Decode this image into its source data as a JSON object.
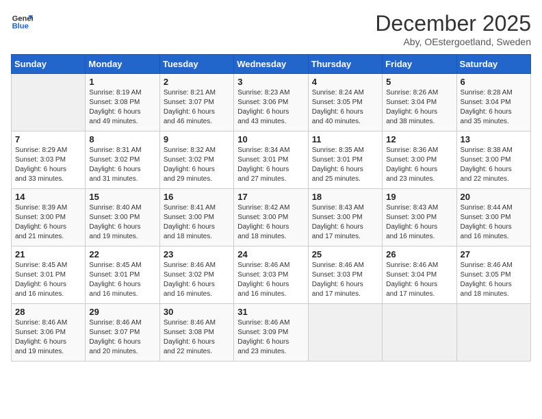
{
  "logo": {
    "line1": "General",
    "line2": "Blue"
  },
  "title": "December 2025",
  "subtitle": "Aby, OEstergoetland, Sweden",
  "days_of_week": [
    "Sunday",
    "Monday",
    "Tuesday",
    "Wednesday",
    "Thursday",
    "Friday",
    "Saturday"
  ],
  "weeks": [
    [
      {
        "day": "",
        "content": ""
      },
      {
        "day": "1",
        "content": "Sunrise: 8:19 AM\nSunset: 3:08 PM\nDaylight: 6 hours\nand 49 minutes."
      },
      {
        "day": "2",
        "content": "Sunrise: 8:21 AM\nSunset: 3:07 PM\nDaylight: 6 hours\nand 46 minutes."
      },
      {
        "day": "3",
        "content": "Sunrise: 8:23 AM\nSunset: 3:06 PM\nDaylight: 6 hours\nand 43 minutes."
      },
      {
        "day": "4",
        "content": "Sunrise: 8:24 AM\nSunset: 3:05 PM\nDaylight: 6 hours\nand 40 minutes."
      },
      {
        "day": "5",
        "content": "Sunrise: 8:26 AM\nSunset: 3:04 PM\nDaylight: 6 hours\nand 38 minutes."
      },
      {
        "day": "6",
        "content": "Sunrise: 8:28 AM\nSunset: 3:04 PM\nDaylight: 6 hours\nand 35 minutes."
      }
    ],
    [
      {
        "day": "7",
        "content": "Sunrise: 8:29 AM\nSunset: 3:03 PM\nDaylight: 6 hours\nand 33 minutes."
      },
      {
        "day": "8",
        "content": "Sunrise: 8:31 AM\nSunset: 3:02 PM\nDaylight: 6 hours\nand 31 minutes."
      },
      {
        "day": "9",
        "content": "Sunrise: 8:32 AM\nSunset: 3:02 PM\nDaylight: 6 hours\nand 29 minutes."
      },
      {
        "day": "10",
        "content": "Sunrise: 8:34 AM\nSunset: 3:01 PM\nDaylight: 6 hours\nand 27 minutes."
      },
      {
        "day": "11",
        "content": "Sunrise: 8:35 AM\nSunset: 3:01 PM\nDaylight: 6 hours\nand 25 minutes."
      },
      {
        "day": "12",
        "content": "Sunrise: 8:36 AM\nSunset: 3:00 PM\nDaylight: 6 hours\nand 23 minutes."
      },
      {
        "day": "13",
        "content": "Sunrise: 8:38 AM\nSunset: 3:00 PM\nDaylight: 6 hours\nand 22 minutes."
      }
    ],
    [
      {
        "day": "14",
        "content": "Sunrise: 8:39 AM\nSunset: 3:00 PM\nDaylight: 6 hours\nand 21 minutes."
      },
      {
        "day": "15",
        "content": "Sunrise: 8:40 AM\nSunset: 3:00 PM\nDaylight: 6 hours\nand 19 minutes."
      },
      {
        "day": "16",
        "content": "Sunrise: 8:41 AM\nSunset: 3:00 PM\nDaylight: 6 hours\nand 18 minutes."
      },
      {
        "day": "17",
        "content": "Sunrise: 8:42 AM\nSunset: 3:00 PM\nDaylight: 6 hours\nand 18 minutes."
      },
      {
        "day": "18",
        "content": "Sunrise: 8:43 AM\nSunset: 3:00 PM\nDaylight: 6 hours\nand 17 minutes."
      },
      {
        "day": "19",
        "content": "Sunrise: 8:43 AM\nSunset: 3:00 PM\nDaylight: 6 hours\nand 16 minutes."
      },
      {
        "day": "20",
        "content": "Sunrise: 8:44 AM\nSunset: 3:00 PM\nDaylight: 6 hours\nand 16 minutes."
      }
    ],
    [
      {
        "day": "21",
        "content": "Sunrise: 8:45 AM\nSunset: 3:01 PM\nDaylight: 6 hours\nand 16 minutes."
      },
      {
        "day": "22",
        "content": "Sunrise: 8:45 AM\nSunset: 3:01 PM\nDaylight: 6 hours\nand 16 minutes."
      },
      {
        "day": "23",
        "content": "Sunrise: 8:46 AM\nSunset: 3:02 PM\nDaylight: 6 hours\nand 16 minutes."
      },
      {
        "day": "24",
        "content": "Sunrise: 8:46 AM\nSunset: 3:03 PM\nDaylight: 6 hours\nand 16 minutes."
      },
      {
        "day": "25",
        "content": "Sunrise: 8:46 AM\nSunset: 3:03 PM\nDaylight: 6 hours\nand 17 minutes."
      },
      {
        "day": "26",
        "content": "Sunrise: 8:46 AM\nSunset: 3:04 PM\nDaylight: 6 hours\nand 17 minutes."
      },
      {
        "day": "27",
        "content": "Sunrise: 8:46 AM\nSunset: 3:05 PM\nDaylight: 6 hours\nand 18 minutes."
      }
    ],
    [
      {
        "day": "28",
        "content": "Sunrise: 8:46 AM\nSunset: 3:06 PM\nDaylight: 6 hours\nand 19 minutes."
      },
      {
        "day": "29",
        "content": "Sunrise: 8:46 AM\nSunset: 3:07 PM\nDaylight: 6 hours\nand 20 minutes."
      },
      {
        "day": "30",
        "content": "Sunrise: 8:46 AM\nSunset: 3:08 PM\nDaylight: 6 hours\nand 22 minutes."
      },
      {
        "day": "31",
        "content": "Sunrise: 8:46 AM\nSunset: 3:09 PM\nDaylight: 6 hours\nand 23 minutes."
      },
      {
        "day": "",
        "content": ""
      },
      {
        "day": "",
        "content": ""
      },
      {
        "day": "",
        "content": ""
      }
    ]
  ]
}
